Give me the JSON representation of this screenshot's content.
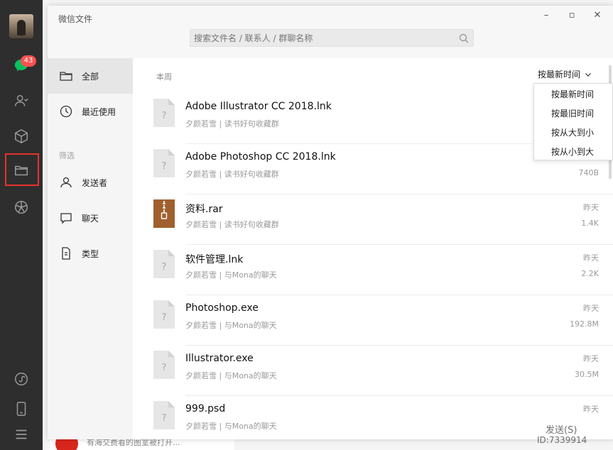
{
  "app": {
    "unread_count": "43"
  },
  "background_chat": {
    "preview_text": "有海交费看的图室被打开..."
  },
  "dialog": {
    "title": "微信文件",
    "search_placeholder": "搜索文件名 / 联系人 / 群聊名称"
  },
  "nav": {
    "items": [
      {
        "label": "全部",
        "icon": "folder-icon",
        "active": true
      },
      {
        "label": "最近使用",
        "icon": "clock-icon",
        "active": false
      }
    ],
    "filter_section": "筛选",
    "filters": [
      {
        "label": "发送者",
        "icon": "person-icon"
      },
      {
        "label": "聊天",
        "icon": "chat-bubble-icon"
      },
      {
        "label": "类型",
        "icon": "document-icon"
      }
    ]
  },
  "list": {
    "group_label": "本周",
    "sort_label": "按最新时间",
    "files": [
      {
        "name": "Adobe Illustrator CC 2018.lnk",
        "meta": "夕颜若雪 | 读书好句收藏群",
        "date": "",
        "size": "",
        "icon": "unknown-file-icon"
      },
      {
        "name": "Adobe Photoshop CC 2018.lnk",
        "meta": "夕颜若雪 | 读书好句收藏群",
        "date": "",
        "size": "740B",
        "icon": "unknown-file-icon"
      },
      {
        "name": "资料.rar",
        "meta": "夕颜若雪 | 读书好句收藏群",
        "date": "昨天",
        "size": "1.4K",
        "icon": "archive-file-icon"
      },
      {
        "name": "软件管理.lnk",
        "meta": "夕颜若雪 | 与Mona的聊天",
        "date": "昨天",
        "size": "2.2K",
        "icon": "unknown-file-icon"
      },
      {
        "name": "Photoshop.exe",
        "meta": "夕颜若雪 | 与Mona的聊天",
        "date": "昨天",
        "size": "192.8M",
        "icon": "unknown-file-icon"
      },
      {
        "name": "Illustrator.exe",
        "meta": "夕颜若雪 | 与Mona的聊天",
        "date": "昨天",
        "size": "30.5M",
        "icon": "unknown-file-icon"
      },
      {
        "name": "999.psd",
        "meta": "夕颜若雪 | 与Mona的聊天",
        "date": "昨天",
        "size": "",
        "icon": "unknown-file-icon"
      }
    ]
  },
  "sort_menu": {
    "options": [
      "按最新时间",
      "按最旧时间",
      "按从大到小",
      "按从小到大"
    ]
  },
  "watermark": {
    "button_text": "发送(S)",
    "id_text": "ID:7339914"
  },
  "colors": {
    "sidebar_bg": "#2e2e2e",
    "badge_red": "#fa5151",
    "highlight_red": "#e8312b",
    "archive_brown": "#a0602e"
  }
}
